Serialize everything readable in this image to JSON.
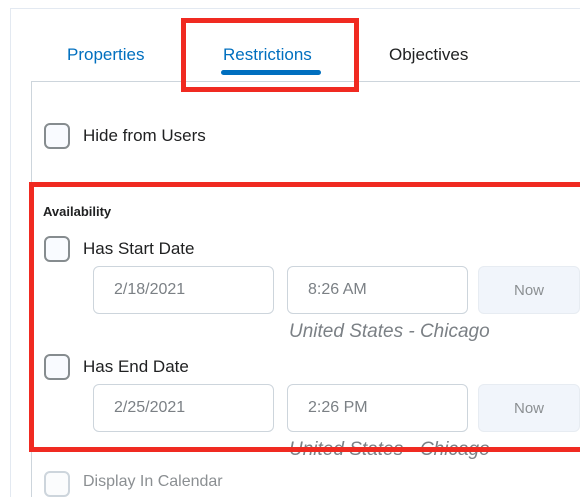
{
  "tabs": {
    "properties": "Properties",
    "restrictions": "Restrictions",
    "objectives": "Objectives"
  },
  "hide_from_users": {
    "label": "Hide from Users"
  },
  "availability": {
    "title": "Availability",
    "start": {
      "label": "Has Start Date",
      "date": "2/18/2021",
      "time": "8:26 AM",
      "now_label": "Now",
      "timezone": "United States - Chicago"
    },
    "end": {
      "label": "Has End Date",
      "date": "2/25/2021",
      "time": "2:26 PM",
      "now_label": "Now",
      "timezone": "United States - Chicago"
    }
  },
  "display_in_calendar": {
    "label": "Display In Calendar"
  },
  "colors": {
    "accent": "#006fbf",
    "highlight": "#f02a21"
  }
}
